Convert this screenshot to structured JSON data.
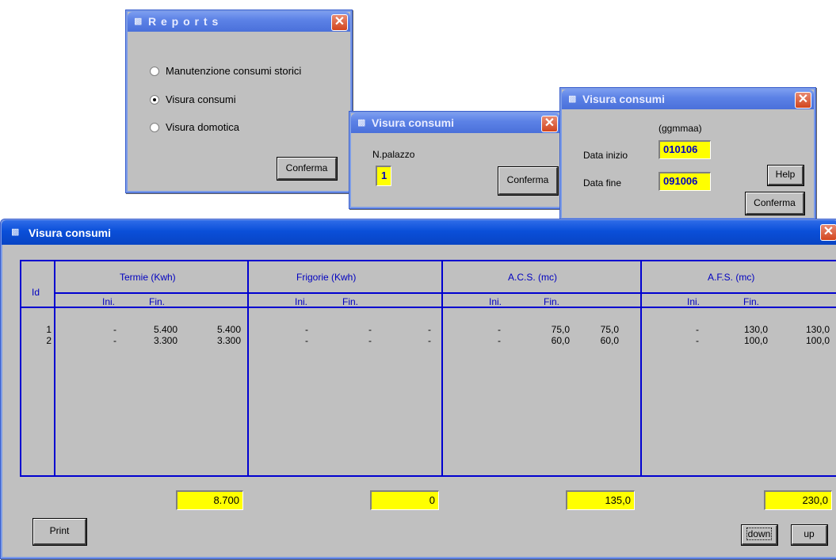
{
  "reports": {
    "title": "R e p o r t s",
    "options": [
      {
        "label": "Manutenzione consumi storici",
        "selected": false
      },
      {
        "label": "Visura consumi",
        "selected": true
      },
      {
        "label": "Visura  domotica",
        "selected": false
      }
    ],
    "confirm_label": "Conferma"
  },
  "palazzo": {
    "title": "Visura consumi",
    "field_label": "N.palazzo",
    "value": "1",
    "confirm_label": "Conferma"
  },
  "dates": {
    "title": "Visura consumi",
    "format_hint": "(ggmmaa)",
    "start_label": "Data inizio",
    "start_value": "010106",
    "end_label": "Data fine",
    "end_value": "091006",
    "help_label": "Help",
    "confirm_label": "Conferma"
  },
  "main": {
    "title": "Visura consumi",
    "id_header": "Id",
    "groups": [
      {
        "name": "Termie  (Kwh)",
        "ini": "Ini.",
        "fin": "Fin.",
        "total": "8.700"
      },
      {
        "name": "Frigorie  (Kwh)",
        "ini": "Ini.",
        "fin": "Fin.",
        "total": "0"
      },
      {
        "name": "A.C.S.  (mc)",
        "ini": "Ini.",
        "fin": "Fin.",
        "total": "135,0"
      },
      {
        "name": "A.F.S.  (mc)",
        "ini": "Ini.",
        "fin": "Fin.",
        "total": "230,0"
      }
    ],
    "rows": [
      {
        "id": "1",
        "cells": [
          "-",
          "5.400",
          "5.400",
          "-",
          "-",
          "-",
          "-",
          "75,0",
          "75,0",
          "-",
          "130,0",
          "130,0"
        ]
      },
      {
        "id": "2",
        "cells": [
          "-",
          "3.300",
          "3.300",
          "-",
          "-",
          "-",
          "-",
          "60,0",
          "60,0",
          "-",
          "100,0",
          "100,0"
        ]
      }
    ],
    "print_label": "Print",
    "down_label": "down",
    "up_label": "up"
  }
}
